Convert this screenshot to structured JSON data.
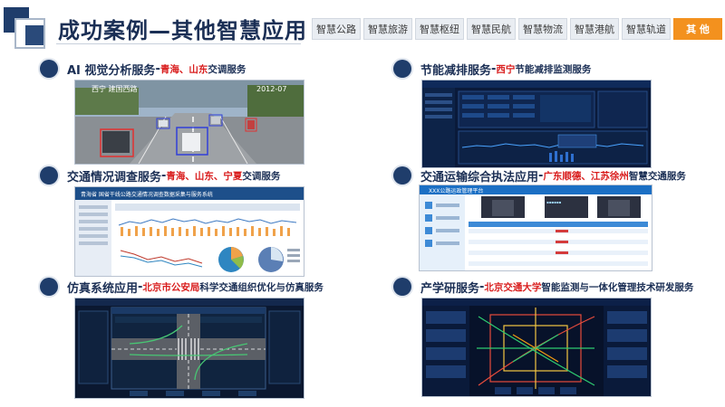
{
  "page": {
    "title": "成功案例—其他智慧应用"
  },
  "tabs": [
    {
      "label": "智慧公路",
      "active": false
    },
    {
      "label": "智慧旅游",
      "active": false
    },
    {
      "label": "智慧枢纽",
      "active": false
    },
    {
      "label": "智慧民航",
      "active": false
    },
    {
      "label": "智慧物流",
      "active": false
    },
    {
      "label": "智慧港航",
      "active": false
    },
    {
      "label": "智慧轨道",
      "active": false
    },
    {
      "label": "其  他",
      "active": true
    }
  ],
  "cases": {
    "ai": {
      "title": "AI 视觉分析服务",
      "sep": "-",
      "red": "青海、山东",
      "tail": "交调服务",
      "screen_caption": "西宁 建国西路",
      "screen_time": "2012-07"
    },
    "traffic": {
      "title": "交通情况调查服务",
      "sep": "-",
      "red": "青海、山东、宁夏",
      "tail": "交调服务",
      "screen_header": "青海省 国省干线公路交通情况调查数据采集与服务系统"
    },
    "sim": {
      "title": "仿真系统应用",
      "sep": "-",
      "red": "北京市公安局",
      "tail": "科学交通组织优化与仿真服务"
    },
    "energy": {
      "title": "节能减排服务",
      "sep": "-",
      "red": "西宁",
      "tail": "节能减排监测服务"
    },
    "enforce": {
      "title": "交通运输综合执法应用",
      "sep": "-",
      "red": "广东顺德、江苏徐州",
      "tail": "智慧交通服务",
      "screen_header": "XXX公路运政管理平台"
    },
    "research": {
      "title": "产学研服务",
      "sep": "-",
      "red": "北京交通大学",
      "tail": "智能监测与一体化管理技术研发服务"
    }
  },
  "colors": {
    "navy": "#1b2f55",
    "red": "#d91e1e",
    "orange": "#f3911e"
  }
}
